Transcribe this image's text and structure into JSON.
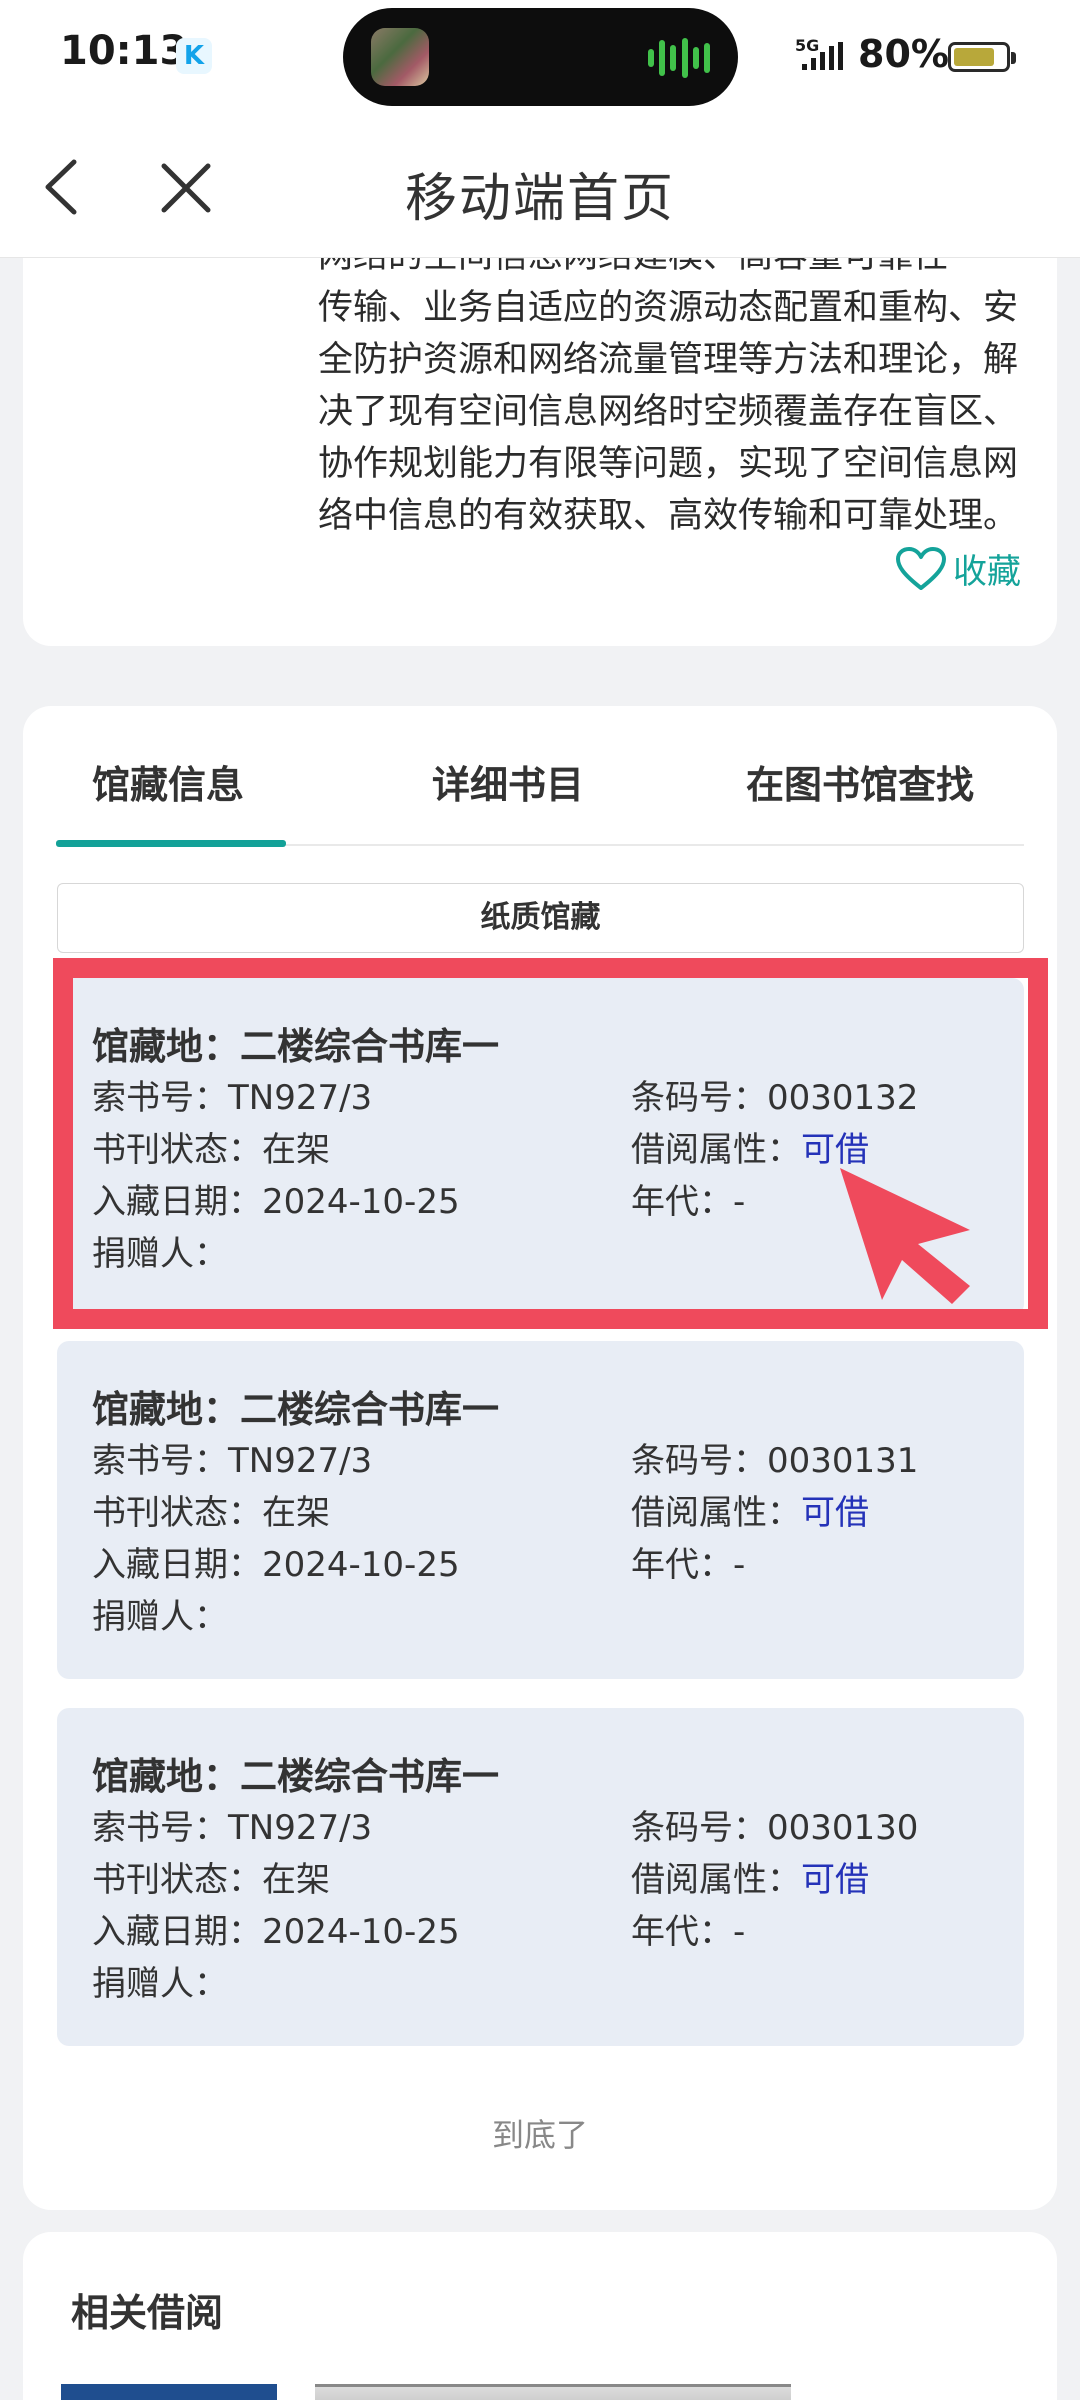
{
  "status_bar": {
    "time": "10:13",
    "network": "5G",
    "battery_percent": "80%",
    "battery_level": 0.8,
    "icons": [
      "k-app-icon",
      "signal-icon",
      "battery-icon"
    ]
  },
  "nav": {
    "title": "移动端首页",
    "back_icon": "chevron-left-icon",
    "close_icon": "close-icon"
  },
  "description": {
    "lines": [
      "网络的空间信息网络建模、高容量可靠性",
      "传输、业务自适应的资源动态配置和重构、安",
      "全防护资源和网络流量管理等方法和理论，解",
      "决了现有空间信息网络时空频覆盖存在盲区、",
      "协作规划能力有限等问题，实现了空间信息网",
      "络中信息的有效获取、高效传输和可靠处理。"
    ],
    "favorite_label": "收藏"
  },
  "holdings": {
    "tabs": [
      "馆藏信息",
      "详细书目",
      "在图书馆查找"
    ],
    "active_tab": 0,
    "subtab": "纸质馆藏",
    "records": [
      {
        "location": "馆藏地：二楼综合书库一",
        "call_no": "索书号：TN927/3",
        "barcode": "条码号：0030132",
        "status": "书刊状态：在架",
        "loan_label": "借阅属性：",
        "loan_value": "可借",
        "date": "入藏日期：2024-10-25",
        "era": "年代：-",
        "donor": "捐赠人："
      },
      {
        "location": "馆藏地：二楼综合书库一",
        "call_no": "索书号：TN927/3",
        "barcode": "条码号：0030131",
        "status": "书刊状态：在架",
        "loan_label": "借阅属性：",
        "loan_value": "可借",
        "date": "入藏日期：2024-10-25",
        "era": "年代：-",
        "donor": "捐赠人："
      },
      {
        "location": "馆藏地：二楼综合书库一",
        "call_no": "索书号：TN927/3",
        "barcode": "条码号：0030130",
        "status": "书刊状态：在架",
        "loan_label": "借阅属性：",
        "loan_value": "可借",
        "date": "入藏日期：2024-10-25",
        "era": "年代：-",
        "donor": "捐赠人："
      }
    ],
    "end_text": "到底了"
  },
  "related": {
    "title": "相关借阅"
  },
  "colors": {
    "accent": "#13a198",
    "highlight": "#ef4a5c",
    "available": "#2432b8",
    "record_bg": "#e8edf5"
  }
}
